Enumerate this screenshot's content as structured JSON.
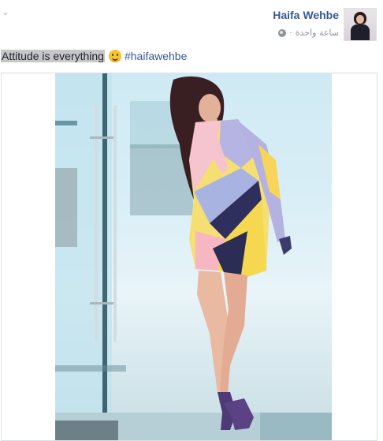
{
  "post": {
    "author": "Haifa Wehbe",
    "timestamp": "ساعة واحدة",
    "separator": "·",
    "privacy_icon": "globe-icon",
    "options_icon": "chevron-down-icon",
    "text": {
      "highlighted": "Attitude is everything",
      "emoji": "slightly-smiling-face",
      "hashtag": "#haifawehbe"
    }
  },
  "colors": {
    "link": "#365899",
    "meta": "#90949c",
    "text": "#1d2129",
    "highlight": "#c7c7c7"
  }
}
